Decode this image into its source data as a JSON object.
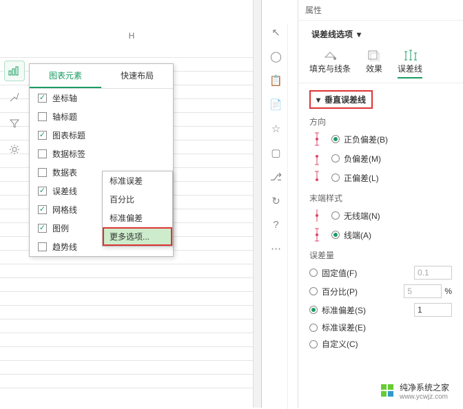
{
  "colhead": "H",
  "tools": [
    "chart",
    "brush",
    "funnel",
    "gear"
  ],
  "popup": {
    "tabs": [
      "图表元素",
      "快速布局"
    ],
    "items": [
      {
        "k": "axes",
        "label": "坐标轴",
        "checked": true
      },
      {
        "k": "axistitle",
        "label": "轴标题",
        "checked": false
      },
      {
        "k": "charttitle",
        "label": "图表标题",
        "checked": true
      },
      {
        "k": "datalabels",
        "label": "数据标签",
        "checked": false
      },
      {
        "k": "datatable",
        "label": "数据表",
        "checked": false
      },
      {
        "k": "errorbars",
        "label": "误差线",
        "checked": true,
        "arrow": true
      },
      {
        "k": "gridlines",
        "label": "网格线",
        "checked": true
      },
      {
        "k": "legend",
        "label": "图例",
        "checked": true
      },
      {
        "k": "trendline",
        "label": "趋势线",
        "checked": false
      }
    ]
  },
  "submenu": [
    "标准误差",
    "百分比",
    "标准偏差",
    "更多选项..."
  ],
  "panel": {
    "title": "属性",
    "dropdown": "误差线选项",
    "tabs": [
      "填充与线条",
      "效果",
      "误差线"
    ],
    "heading": "垂直误差线",
    "direction": {
      "label": "方向",
      "opts": [
        "正负偏差(B)",
        "负偏差(M)",
        "正偏差(L)"
      ],
      "on": 0
    },
    "endstyle": {
      "label": "末端样式",
      "opts": [
        "无线端(N)",
        "线端(A)"
      ],
      "on": 1
    },
    "amount": {
      "label": "误差量",
      "rows": [
        {
          "k": "fixed",
          "label": "固定值(F)",
          "val": "0.1",
          "on": false
        },
        {
          "k": "pct",
          "label": "百分比(P)",
          "val": "5",
          "suffix": "%",
          "on": false
        },
        {
          "k": "stddev",
          "label": "标准偏差(S)",
          "val": "1",
          "on": true
        },
        {
          "k": "stderr",
          "label": "标准误差(E)",
          "on": false
        },
        {
          "k": "custom",
          "label": "自定义(C)",
          "on": false
        }
      ]
    }
  },
  "watermark": {
    "text": "纯净系统之家",
    "url": "www.ycwjz.com"
  }
}
